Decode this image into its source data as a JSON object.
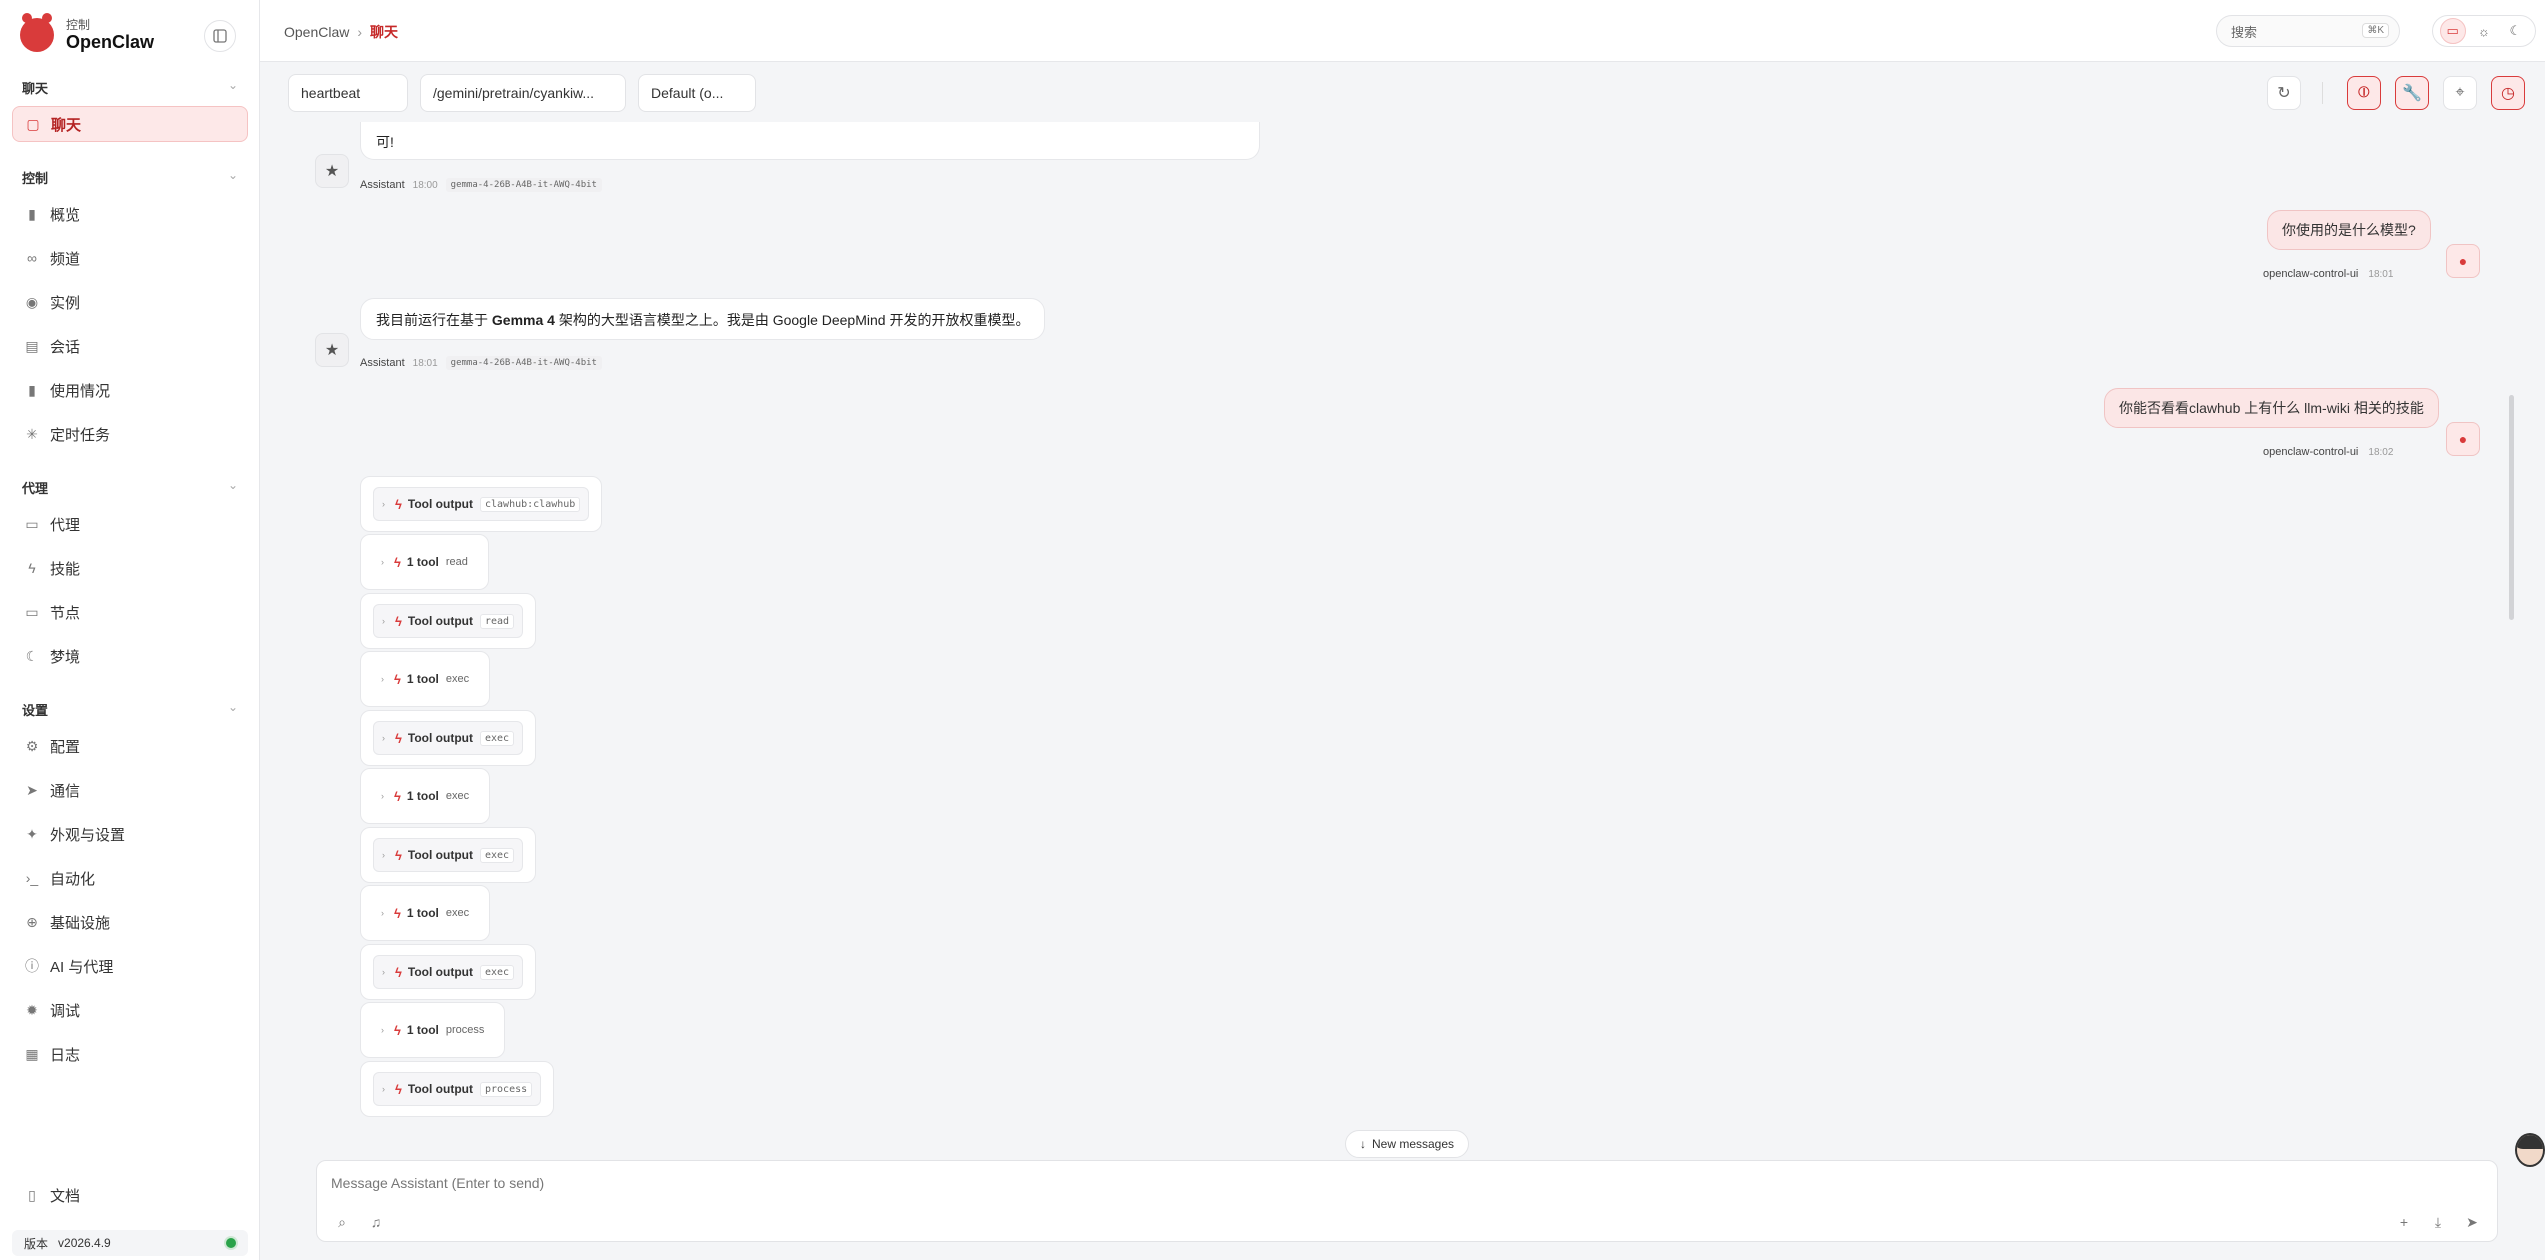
{
  "sidebar": {
    "brand_eyebrow": "控制",
    "brand_name": "OpenClaw",
    "sections": {
      "chat": "聊天",
      "control": "控制",
      "agent": "代理",
      "settings": "设置"
    },
    "items": [
      {
        "label": "聊天",
        "icon": "chat-bubble-icon"
      },
      {
        "label": "概览",
        "icon": "bar-chart-icon"
      },
      {
        "label": "频道",
        "icon": "link-icon"
      },
      {
        "label": "实例",
        "icon": "radio-icon"
      },
      {
        "label": "会话",
        "icon": "document-icon"
      },
      {
        "label": "使用情况",
        "icon": "bar-chart-icon"
      },
      {
        "label": "定时任务",
        "icon": "loader-icon"
      },
      {
        "label": "代理",
        "icon": "folder-icon"
      },
      {
        "label": "技能",
        "icon": "bolt-icon"
      },
      {
        "label": "节点",
        "icon": "monitor-icon"
      },
      {
        "label": "梦境",
        "icon": "moon-icon"
      },
      {
        "label": "配置",
        "icon": "gear-icon"
      },
      {
        "label": "通信",
        "icon": "send-icon"
      },
      {
        "label": "外观与设置",
        "icon": "sparkle-icon"
      },
      {
        "label": "自动化",
        "icon": "terminal-icon"
      },
      {
        "label": "基础设施",
        "icon": "globe-icon"
      },
      {
        "label": "AI 与代理",
        "icon": "info-icon"
      },
      {
        "label": "调试",
        "icon": "bug-icon"
      },
      {
        "label": "日志",
        "icon": "scroll-icon"
      }
    ],
    "docs": "文档",
    "version_label": "版本",
    "version": "v2026.4.9",
    "status_color": "#2aa34a"
  },
  "topbar": {
    "breadcrumb_root": "OpenClaw",
    "breadcrumb_current": "聊天",
    "search_placeholder": "搜索",
    "search_shortcut": "⌘K"
  },
  "toolbar": {
    "session": "heartbeat",
    "model_path": "/gemini/pretrain/cyankiw...",
    "mode": "Default (o..."
  },
  "messages": {
    "partial_assistant": "可!",
    "assistant_label": "Assistant",
    "assistant_time_1": "18:00",
    "model_tag": "gemma-4-26B-A4B-it-AWQ-4bit",
    "user_1": "你使用的是什么模型?",
    "user_label": "openclaw-control-ui",
    "user_time_1": "18:01",
    "assistant_2_pre": "我目前运行在基于 ",
    "assistant_2_bold": "Gemma 4",
    "assistant_2_post": " 架构的大型语言模型之上。我是由 Google DeepMind 开发的开放权重模型。",
    "assistant_time_2": "18:01",
    "user_2": "你能否看看clawhub 上有什么 llm-wiki 相关的技能",
    "user_time_2": "18:02"
  },
  "tools": [
    {
      "label": "Tool output",
      "name": "clawhub:clawhub",
      "kind": "out"
    },
    {
      "label": "1 tool",
      "name": "read",
      "kind": "cnt"
    },
    {
      "label": "Tool output",
      "name": "read",
      "kind": "out"
    },
    {
      "label": "1 tool",
      "name": "exec",
      "kind": "cnt"
    },
    {
      "label": "Tool output",
      "name": "exec",
      "kind": "out"
    },
    {
      "label": "1 tool",
      "name": "exec",
      "kind": "cnt"
    },
    {
      "label": "Tool output",
      "name": "exec",
      "kind": "out"
    },
    {
      "label": "1 tool",
      "name": "exec",
      "kind": "cnt"
    },
    {
      "label": "Tool output",
      "name": "exec",
      "kind": "out"
    },
    {
      "label": "1 tool",
      "name": "process",
      "kind": "cnt"
    },
    {
      "label": "Tool output",
      "name": "process",
      "kind": "out"
    }
  ],
  "new_messages": "New messages",
  "composer": {
    "placeholder": "Message Assistant (Enter to send)"
  },
  "colors": {
    "accent": "#d93b3b",
    "accent_bg": "#fde8e8"
  }
}
